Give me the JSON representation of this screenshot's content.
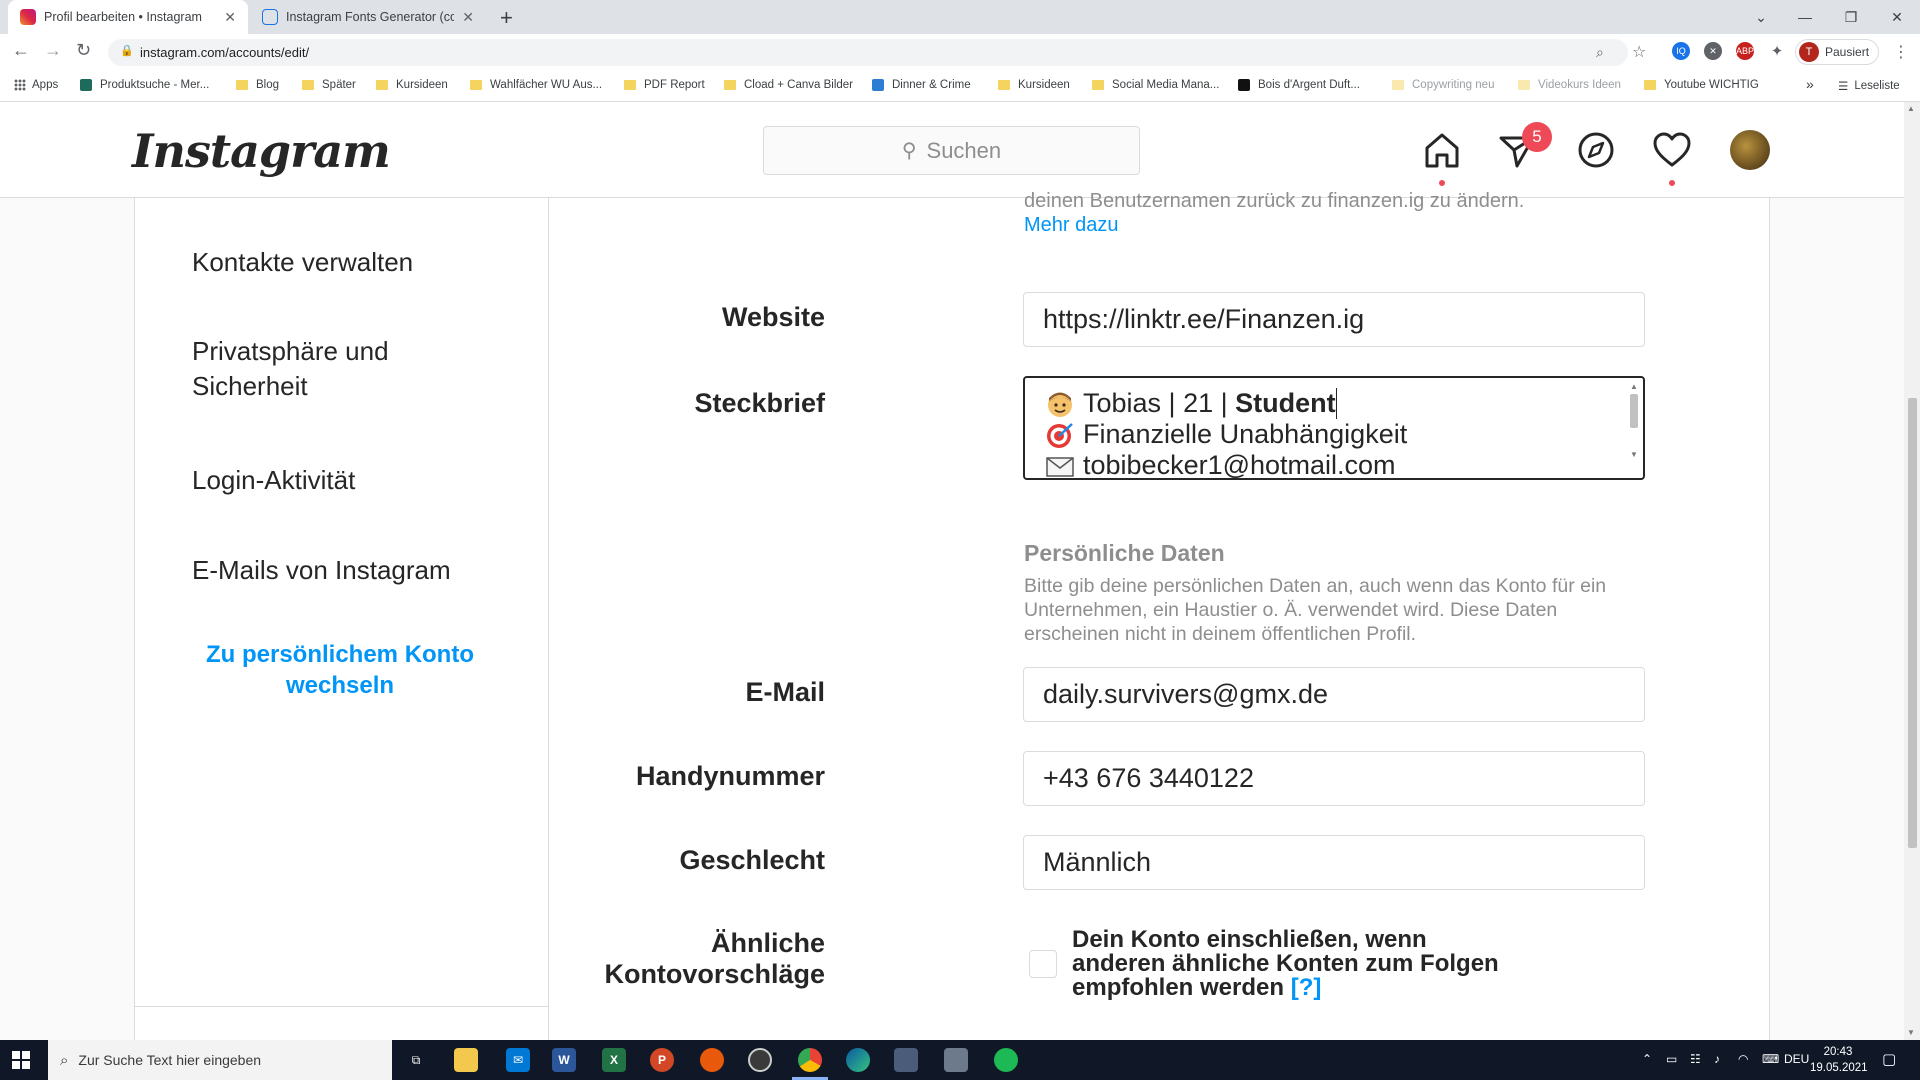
{
  "browser": {
    "tabs": [
      {
        "title": "Profil bearbeiten • Instagram",
        "active": true
      },
      {
        "title": "Instagram Fonts Generator (co p",
        "active": false
      }
    ],
    "url": "instagram.com/accounts/edit/",
    "profile_initial": "T",
    "profile_label": "Pausiert",
    "bookmarks": [
      {
        "label": "Apps",
        "icon": "apps-grid-icon"
      },
      {
        "label": "Produktsuche - Mer...",
        "icon": "site-icon"
      },
      {
        "label": "Blog",
        "icon": "folder-icon"
      },
      {
        "label": "Später",
        "icon": "folder-icon"
      },
      {
        "label": "Kursideen",
        "icon": "folder-icon"
      },
      {
        "label": "Wahlfächer WU Aus...",
        "icon": "folder-icon"
      },
      {
        "label": "PDF Report",
        "icon": "folder-icon"
      },
      {
        "label": "Cload + Canva Bilder",
        "icon": "folder-icon"
      },
      {
        "label": "Dinner & Crime",
        "icon": "site-icon"
      },
      {
        "label": "Kursideen",
        "icon": "folder-icon"
      },
      {
        "label": "Social Media Mana...",
        "icon": "folder-icon"
      },
      {
        "label": "Bois d'Argent Duft...",
        "icon": "site-icon"
      },
      {
        "label": "Copywriting neu",
        "icon": "folder-icon"
      },
      {
        "label": "Videokurs Ideen",
        "icon": "folder-icon"
      },
      {
        "label": "Youtube WICHTIG",
        "icon": "folder-icon"
      }
    ],
    "reading_list": "Leseliste",
    "more_bookmarks": "»"
  },
  "ig": {
    "logo": "Instagram",
    "search_placeholder": "Suchen",
    "activity_badge": "5"
  },
  "sidebar": {
    "items": [
      {
        "label": "Kontakte verwalten"
      },
      {
        "label": "Privatsphäre und Sicherheit"
      },
      {
        "label": "Login-Aktivität"
      },
      {
        "label": "E-Mails von Instagram"
      }
    ],
    "switch_link": "Zu persönlichem Konto wechseln"
  },
  "form": {
    "top_hint": "deinen Benutzernamen zurück zu finanzen.ig zu ändern.",
    "more_link": "Mehr dazu",
    "website": {
      "label": "Website",
      "value": "https://linktr.ee/Finanzen.ig"
    },
    "bio": {
      "label": "Steckbrief",
      "line1_plain": "Tobias | 21 | ",
      "line1_bold": "Student",
      "line2": "Finanzielle Unabhängigkeit",
      "line3": "tobibecker1@hotmail.com"
    },
    "personal": {
      "title": "Persönliche Daten",
      "desc": "Bitte gib deine persönlichen Daten an, auch wenn das Konto für ein Unternehmen, ein Haustier o. Ä. verwendet wird. Diese Daten erscheinen nicht in deinem öffentlichen Profil."
    },
    "email": {
      "label": "E-Mail",
      "value": "daily.survivers@gmx.de"
    },
    "phone": {
      "label": "Handynummer",
      "value": "+43 676 3440122"
    },
    "gender": {
      "label": "Geschlecht",
      "value": "Männlich"
    },
    "similar": {
      "label": "Ähnliche Kontovorschläge",
      "text": "Dein Konto einschließen, wenn anderen ähnliche Konten zum Folgen empfohlen werden",
      "help": "[?]"
    }
  },
  "taskbar": {
    "search_placeholder": "Zur Suche Text hier eingeben",
    "language": "DEU",
    "time": "20:43",
    "date": "19.05.2021"
  }
}
